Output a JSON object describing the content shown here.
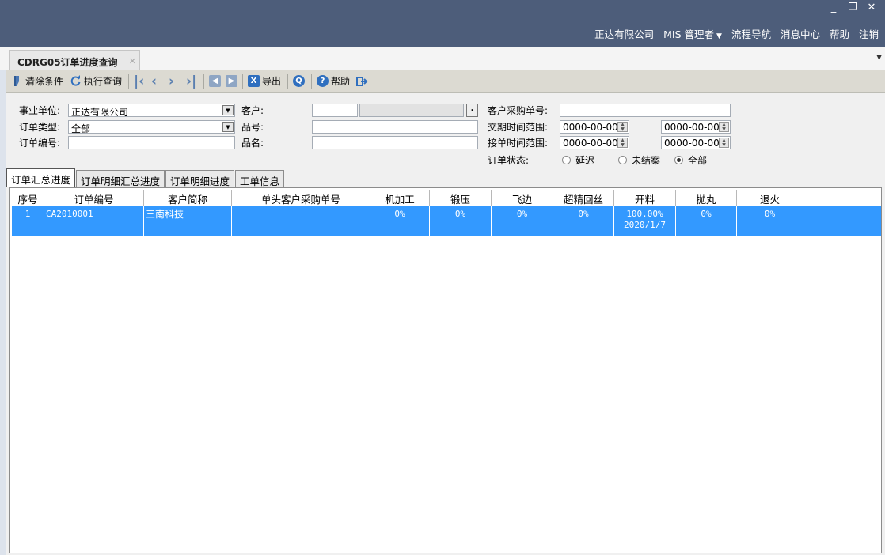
{
  "window_controls": [
    "_",
    "❐",
    "✕"
  ],
  "topnav": {
    "company": "正达有限公司",
    "user": "MIS 管理者",
    "process_nav": "流程导航",
    "message_center": "消息中心",
    "help": "帮助",
    "logout": "注销"
  },
  "page_tab": {
    "title": "CDRG05订单进度查询",
    "close": "✕"
  },
  "toolbar": {
    "clear_label": "清除条件",
    "execute_label": "执行查询",
    "export_label": "导出",
    "help_label": "帮助"
  },
  "form": {
    "business_unit_label": "事业单位:",
    "business_unit_value": "正达有限公司",
    "order_type_label": "订单类型:",
    "order_type_value": "全部",
    "order_no_label": "订单编号:",
    "order_no_value": "",
    "customer_label": "客户:",
    "customer_code": "",
    "customer_name": "",
    "part_no_label": "品号:",
    "part_no_value": "",
    "part_name_label": "品名:",
    "part_name_value": "",
    "customer_po_label": "客户采购单号:",
    "customer_po_value": "",
    "delivery_range_label": "交期时间范围:",
    "delivery_from": "0000-00-00",
    "delivery_to": "0000-00-00",
    "accept_range_label": "接单时间范围:",
    "accept_from": "0000-00-00",
    "accept_to": "0000-00-00",
    "range_sep": "-",
    "status_label": "订单状态:",
    "status_options": [
      "延迟",
      "未结案",
      "全部"
    ],
    "status_selected": "全部"
  },
  "subtabs": [
    "订单汇总进度",
    "订单明细汇总进度",
    "订单明细进度",
    "工单信息"
  ],
  "grid": {
    "columns": [
      "序号",
      "订单编号",
      "客户简称",
      "单头客户采购单号",
      "机加工",
      "锻压",
      "飞边",
      "超精回丝",
      "开料",
      "抛丸",
      "退火"
    ],
    "rows": [
      [
        "1",
        "CA2010001",
        "三南科技",
        "",
        "0%",
        "0%",
        "0%",
        "0%",
        "100.00%\n2020/1/7",
        "0%",
        "0%"
      ]
    ]
  },
  "colors": {
    "header_bg": "#4d5d7a",
    "selected_row": "#3399ff"
  }
}
